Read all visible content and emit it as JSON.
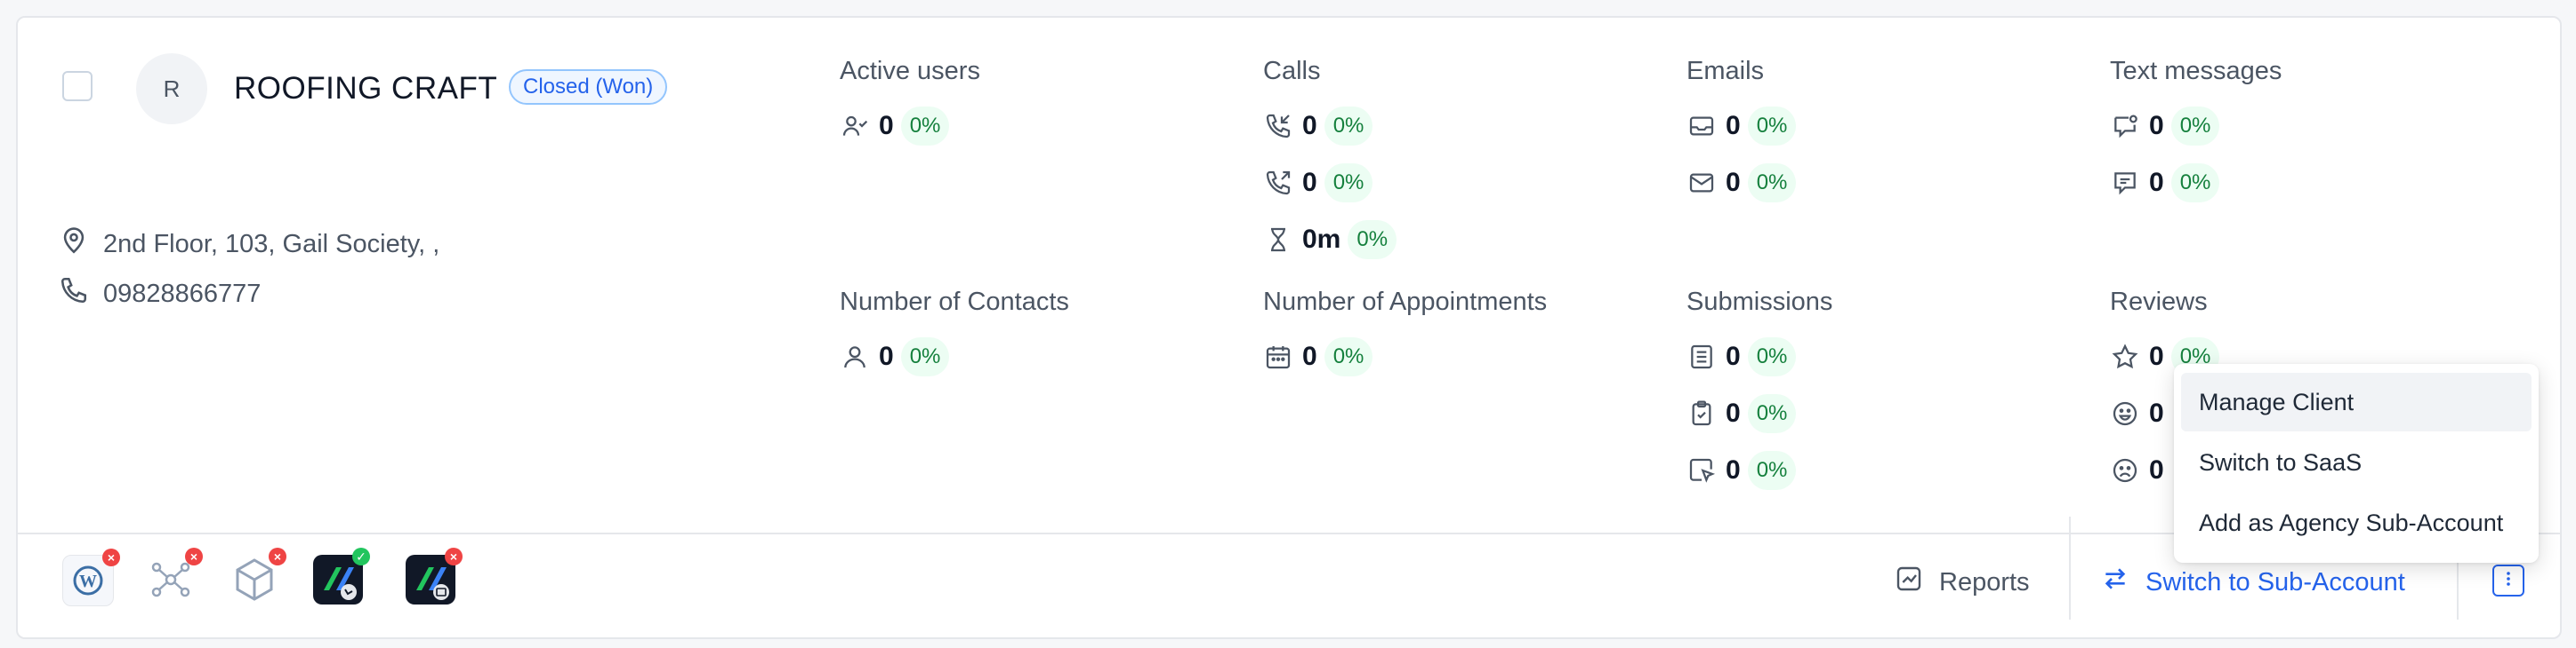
{
  "client": {
    "avatar_initial": "R",
    "name": "ROOFING CRAFT",
    "status": "Closed (Won)",
    "address": "2nd Floor, 103, Gail Society, ,",
    "phone": "09828866777"
  },
  "metrics": {
    "active_users": {
      "title": "Active users",
      "rows": [
        {
          "icon": "users-check-icon",
          "value": "0",
          "pct": "0%"
        }
      ]
    },
    "calls": {
      "title": "Calls",
      "rows": [
        {
          "icon": "phone-incoming-icon",
          "value": "0",
          "pct": "0%"
        },
        {
          "icon": "phone-outgoing-icon",
          "value": "0",
          "pct": "0%"
        },
        {
          "icon": "hourglass-icon",
          "value": "0m",
          "pct": "0%"
        }
      ]
    },
    "emails": {
      "title": "Emails",
      "rows": [
        {
          "icon": "inbox-icon",
          "value": "0",
          "pct": "0%"
        },
        {
          "icon": "mail-icon",
          "value": "0",
          "pct": "0%"
        }
      ]
    },
    "text_messages": {
      "title": "Text messages",
      "rows": [
        {
          "icon": "message-dot-icon",
          "value": "0",
          "pct": "0%"
        },
        {
          "icon": "message-text-icon",
          "value": "0",
          "pct": "0%"
        }
      ]
    },
    "contacts": {
      "title": "Number of Contacts",
      "rows": [
        {
          "icon": "user-icon",
          "value": "0",
          "pct": "0%"
        }
      ]
    },
    "appointments": {
      "title": "Number of Appointments",
      "rows": [
        {
          "icon": "calendar-icon",
          "value": "0",
          "pct": "0%"
        }
      ]
    },
    "submissions": {
      "title": "Submissions",
      "rows": [
        {
          "icon": "list-icon",
          "value": "0",
          "pct": "0%"
        },
        {
          "icon": "clipboard-check-icon",
          "value": "0",
          "pct": "0%"
        },
        {
          "icon": "cursor-click-icon",
          "value": "0",
          "pct": "0%"
        }
      ]
    },
    "reviews": {
      "title": "Reviews",
      "rows": [
        {
          "icon": "star-icon",
          "value": "0",
          "pct": "0%"
        },
        {
          "icon": "smile-icon",
          "value": "0"
        },
        {
          "icon": "frown-icon",
          "value": "0"
        }
      ]
    }
  },
  "footer": {
    "plugins": [
      {
        "icon": "wordpress-icon",
        "status": "error"
      },
      {
        "icon": "network-icon",
        "status": "error"
      },
      {
        "icon": "cube-icon",
        "status": "error"
      },
      {
        "icon": "app-phone-icon",
        "status": "ok"
      },
      {
        "icon": "app-mail-icon",
        "status": "error"
      }
    ],
    "reports_label": "Reports",
    "switch_label": "Switch to Sub-Account"
  },
  "menu": {
    "items": [
      "Manage Client",
      "Switch to SaaS",
      "Add as Agency Sub-Account"
    ]
  },
  "colors": {
    "accent": "#2563eb",
    "pct_bg": "#ecfdf3",
    "pct_text": "#15803d",
    "error": "#ef4444",
    "ok": "#22c55e"
  }
}
